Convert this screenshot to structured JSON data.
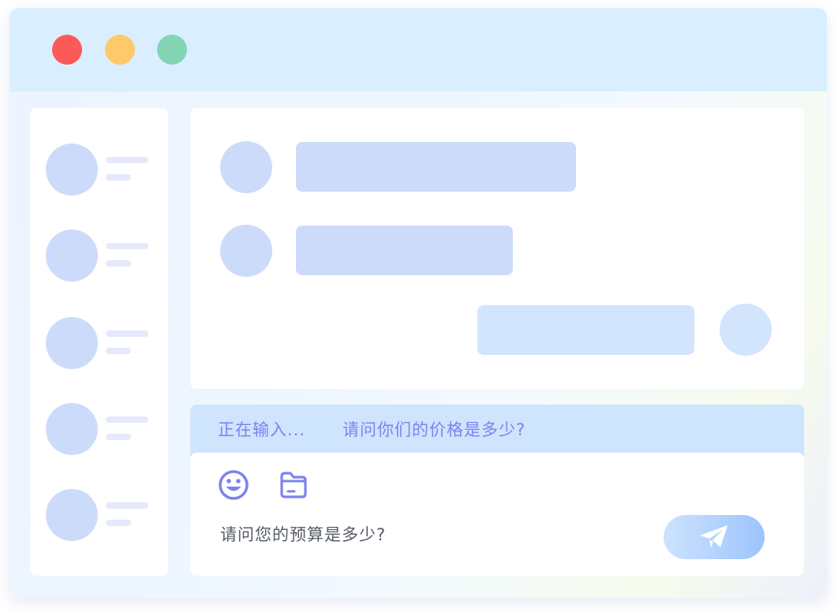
{
  "window": {
    "controls": {
      "close_color": "#fc5a58",
      "minimize_color": "#fec968",
      "maximize_color": "#84d4b6"
    }
  },
  "sidebar": {
    "contacts": [
      {
        "id": 1
      },
      {
        "id": 2
      },
      {
        "id": 3
      },
      {
        "id": 4
      },
      {
        "id": 5
      }
    ]
  },
  "chat": {
    "messages": [
      {
        "side": "incoming",
        "bubble_color": "#cddbfb"
      },
      {
        "side": "incoming",
        "bubble_color": "#cddbfb"
      },
      {
        "side": "outgoing",
        "bubble_color": "#d3e4fd"
      }
    ]
  },
  "typing": {
    "status": "正在输入...",
    "preview": "请问你们的价格是多少?"
  },
  "composer": {
    "tools": [
      {
        "icon": "smiley-icon"
      },
      {
        "icon": "folder-icon"
      }
    ],
    "input_text": "请问您的预算是多少?",
    "send_icon": "paper-plane-icon"
  },
  "colors": {
    "accent": "#7b83ef",
    "titlebar": "#d9efff",
    "placeholder": "#cddbfb"
  }
}
